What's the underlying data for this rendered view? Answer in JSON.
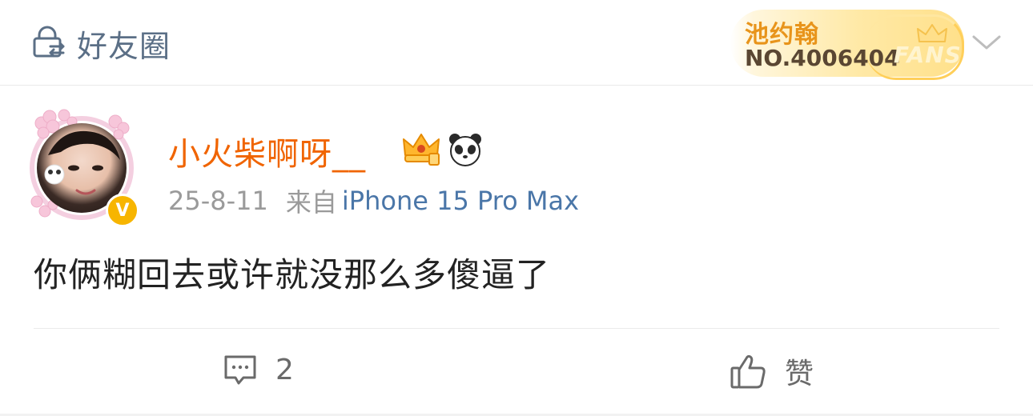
{
  "header": {
    "friends_circle_label": "好友圈",
    "friends_circle_icon": "friends-lock-icon",
    "fans_badge": {
      "name": "池约翰",
      "number": "NO.4006404",
      "word": "FANS"
    },
    "dropdown_icon": "chevron-down-icon"
  },
  "post": {
    "username": "小火柴啊呀__",
    "verified_mark": "V",
    "date": "25-8-11",
    "from_label": "来自",
    "device": "iPhone 15 Pro Max",
    "text": "你俩糊回去或许就没那么多傻逼了"
  },
  "actions": {
    "comment_count": "2",
    "like_label": "赞"
  },
  "colors": {
    "username": "#f06400",
    "device_link": "#4a76a8",
    "friends_label": "#5b6f86",
    "verified": "#f7b500",
    "fans_name": "#e8941b"
  }
}
